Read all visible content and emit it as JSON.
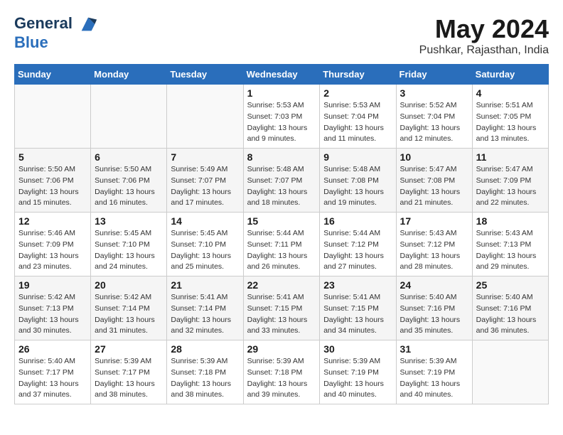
{
  "header": {
    "logo_line1": "General",
    "logo_line2": "Blue",
    "month": "May 2024",
    "location": "Pushkar, Rajasthan, India"
  },
  "days_of_week": [
    "Sunday",
    "Monday",
    "Tuesday",
    "Wednesday",
    "Thursday",
    "Friday",
    "Saturday"
  ],
  "weeks": [
    [
      {
        "day": "",
        "info": ""
      },
      {
        "day": "",
        "info": ""
      },
      {
        "day": "",
        "info": ""
      },
      {
        "day": "1",
        "info": "Sunrise: 5:53 AM\nSunset: 7:03 PM\nDaylight: 13 hours\nand 9 minutes."
      },
      {
        "day": "2",
        "info": "Sunrise: 5:53 AM\nSunset: 7:04 PM\nDaylight: 13 hours\nand 11 minutes."
      },
      {
        "day": "3",
        "info": "Sunrise: 5:52 AM\nSunset: 7:04 PM\nDaylight: 13 hours\nand 12 minutes."
      },
      {
        "day": "4",
        "info": "Sunrise: 5:51 AM\nSunset: 7:05 PM\nDaylight: 13 hours\nand 13 minutes."
      }
    ],
    [
      {
        "day": "5",
        "info": "Sunrise: 5:50 AM\nSunset: 7:06 PM\nDaylight: 13 hours\nand 15 minutes."
      },
      {
        "day": "6",
        "info": "Sunrise: 5:50 AM\nSunset: 7:06 PM\nDaylight: 13 hours\nand 16 minutes."
      },
      {
        "day": "7",
        "info": "Sunrise: 5:49 AM\nSunset: 7:07 PM\nDaylight: 13 hours\nand 17 minutes."
      },
      {
        "day": "8",
        "info": "Sunrise: 5:48 AM\nSunset: 7:07 PM\nDaylight: 13 hours\nand 18 minutes."
      },
      {
        "day": "9",
        "info": "Sunrise: 5:48 AM\nSunset: 7:08 PM\nDaylight: 13 hours\nand 19 minutes."
      },
      {
        "day": "10",
        "info": "Sunrise: 5:47 AM\nSunset: 7:08 PM\nDaylight: 13 hours\nand 21 minutes."
      },
      {
        "day": "11",
        "info": "Sunrise: 5:47 AM\nSunset: 7:09 PM\nDaylight: 13 hours\nand 22 minutes."
      }
    ],
    [
      {
        "day": "12",
        "info": "Sunrise: 5:46 AM\nSunset: 7:09 PM\nDaylight: 13 hours\nand 23 minutes."
      },
      {
        "day": "13",
        "info": "Sunrise: 5:45 AM\nSunset: 7:10 PM\nDaylight: 13 hours\nand 24 minutes."
      },
      {
        "day": "14",
        "info": "Sunrise: 5:45 AM\nSunset: 7:10 PM\nDaylight: 13 hours\nand 25 minutes."
      },
      {
        "day": "15",
        "info": "Sunrise: 5:44 AM\nSunset: 7:11 PM\nDaylight: 13 hours\nand 26 minutes."
      },
      {
        "day": "16",
        "info": "Sunrise: 5:44 AM\nSunset: 7:12 PM\nDaylight: 13 hours\nand 27 minutes."
      },
      {
        "day": "17",
        "info": "Sunrise: 5:43 AM\nSunset: 7:12 PM\nDaylight: 13 hours\nand 28 minutes."
      },
      {
        "day": "18",
        "info": "Sunrise: 5:43 AM\nSunset: 7:13 PM\nDaylight: 13 hours\nand 29 minutes."
      }
    ],
    [
      {
        "day": "19",
        "info": "Sunrise: 5:42 AM\nSunset: 7:13 PM\nDaylight: 13 hours\nand 30 minutes."
      },
      {
        "day": "20",
        "info": "Sunrise: 5:42 AM\nSunset: 7:14 PM\nDaylight: 13 hours\nand 31 minutes."
      },
      {
        "day": "21",
        "info": "Sunrise: 5:41 AM\nSunset: 7:14 PM\nDaylight: 13 hours\nand 32 minutes."
      },
      {
        "day": "22",
        "info": "Sunrise: 5:41 AM\nSunset: 7:15 PM\nDaylight: 13 hours\nand 33 minutes."
      },
      {
        "day": "23",
        "info": "Sunrise: 5:41 AM\nSunset: 7:15 PM\nDaylight: 13 hours\nand 34 minutes."
      },
      {
        "day": "24",
        "info": "Sunrise: 5:40 AM\nSunset: 7:16 PM\nDaylight: 13 hours\nand 35 minutes."
      },
      {
        "day": "25",
        "info": "Sunrise: 5:40 AM\nSunset: 7:16 PM\nDaylight: 13 hours\nand 36 minutes."
      }
    ],
    [
      {
        "day": "26",
        "info": "Sunrise: 5:40 AM\nSunset: 7:17 PM\nDaylight: 13 hours\nand 37 minutes."
      },
      {
        "day": "27",
        "info": "Sunrise: 5:39 AM\nSunset: 7:17 PM\nDaylight: 13 hours\nand 38 minutes."
      },
      {
        "day": "28",
        "info": "Sunrise: 5:39 AM\nSunset: 7:18 PM\nDaylight: 13 hours\nand 38 minutes."
      },
      {
        "day": "29",
        "info": "Sunrise: 5:39 AM\nSunset: 7:18 PM\nDaylight: 13 hours\nand 39 minutes."
      },
      {
        "day": "30",
        "info": "Sunrise: 5:39 AM\nSunset: 7:19 PM\nDaylight: 13 hours\nand 40 minutes."
      },
      {
        "day": "31",
        "info": "Sunrise: 5:39 AM\nSunset: 7:19 PM\nDaylight: 13 hours\nand 40 minutes."
      },
      {
        "day": "",
        "info": ""
      }
    ]
  ]
}
